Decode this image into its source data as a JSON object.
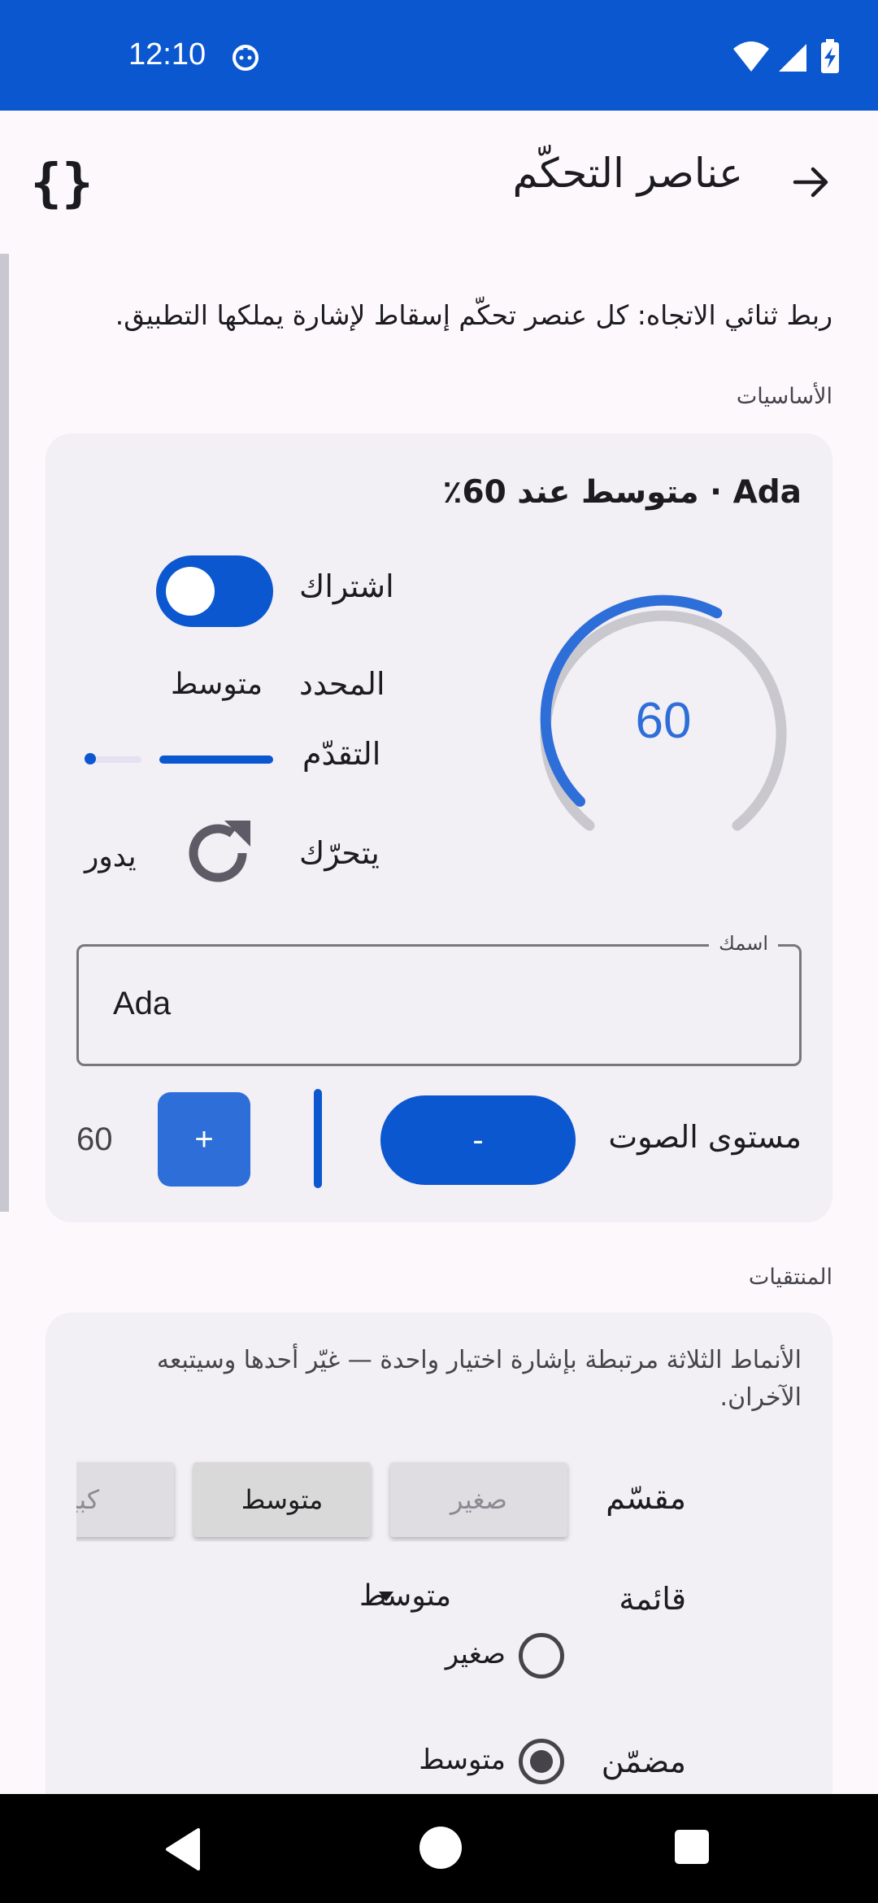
{
  "status_bar": {
    "time": "12:10",
    "icons": [
      "cat-icon",
      "wifi-icon",
      "signal-icon",
      "battery-charging-icon"
    ],
    "color": "#0b57cf"
  },
  "app_bar": {
    "title": "عناصر التحكّم",
    "back_icon": "arrow-right-icon",
    "code_icon": "code-braces-icon",
    "code_label": "{}"
  },
  "subtitle": "ربط ثنائي الاتجاه: كل عنصر تحكّم إسقاط لإشارة يملكها التطبيق.",
  "basics": {
    "section_label": "الأساسيات",
    "card_title": "Ada · متوسط عند 60٪",
    "subscribe_label": "اشتراك",
    "subscribe_on": true,
    "selected_label": "المحدد",
    "selected_value": "متوسط",
    "progress_label": "التقدّم",
    "progress_value": 0.6,
    "moving_label": "يتحرّك",
    "spinning_text": "يدور",
    "gauge_value": "60",
    "gauge_fraction": 0.6,
    "name_field": {
      "label": "اسمك",
      "value": "Ada"
    },
    "volume": {
      "label": "مستوى الصوت",
      "minus_label": "-",
      "plus_label": "+",
      "value": "60"
    }
  },
  "selectors": {
    "section_label": "المنتقيات",
    "description": "الأنماط الثلاثة مرتبطة بإشارة اختيار واحدة — غيّر أحدها وسيتبعه الآخران.",
    "segmented": {
      "label": "مقسّم",
      "options": [
        "صغير",
        "متوسط",
        "كبير"
      ],
      "selected": "متوسط"
    },
    "dropdown": {
      "label": "قائمة",
      "value": "متوسط"
    },
    "radio": {
      "label": "مضمّن",
      "options": [
        "صغير",
        "متوسط"
      ],
      "selected": "متوسط"
    }
  },
  "nav_bar": {
    "icons": [
      "nav-back-icon",
      "nav-home-icon",
      "nav-recents-icon"
    ]
  }
}
